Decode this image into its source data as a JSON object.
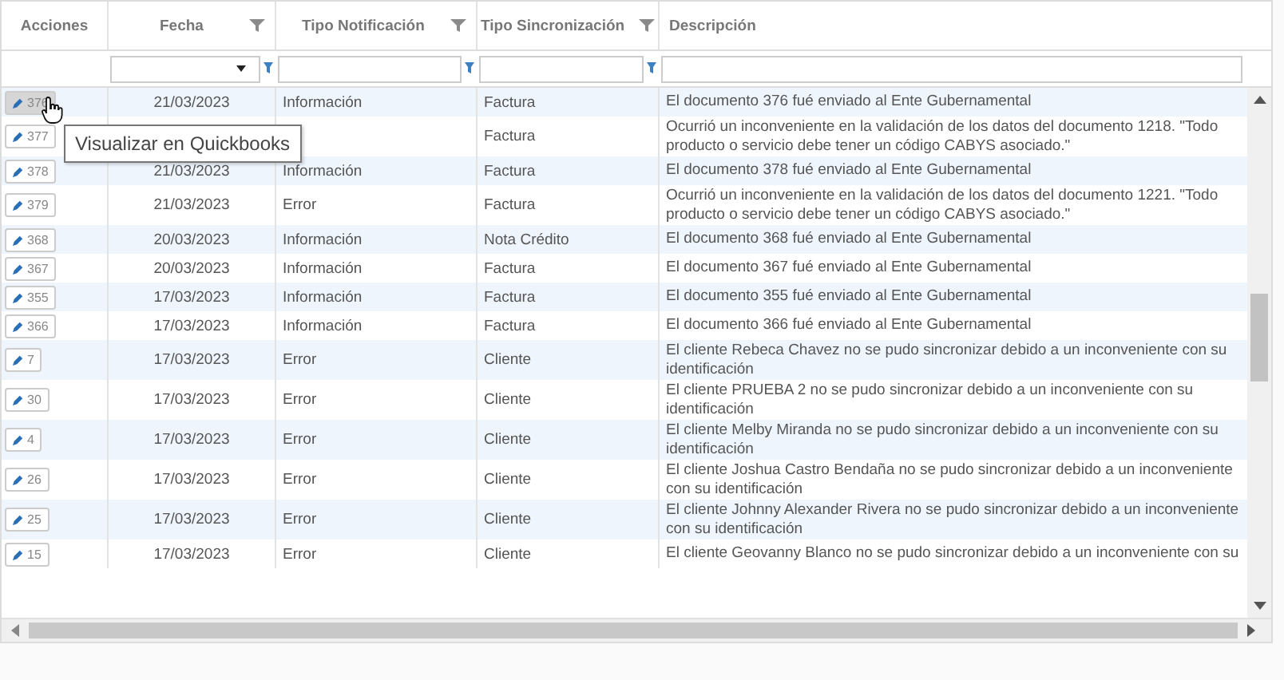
{
  "columns": [
    {
      "label": "Acciones",
      "filterable": false
    },
    {
      "label": "Fecha",
      "filterable": true
    },
    {
      "label": "Tipo Notificación",
      "filterable": true
    },
    {
      "label": "Tipo Sincronización",
      "filterable": true
    },
    {
      "label": "Descripción",
      "filterable": false
    }
  ],
  "filters": [
    {
      "kind": "dropdown"
    },
    {
      "kind": "text"
    },
    {
      "kind": "text"
    },
    {
      "kind": "text"
    }
  ],
  "rows": [
    {
      "id": "376",
      "date": "21/03/2023",
      "notification": "Información",
      "sync": "Factura",
      "description": "El documento 376 fué enviado al Ente Gubernamental",
      "hovered": true
    },
    {
      "id": "377",
      "sync": "Factura",
      "description": "Ocurrió un inconveniente en la validación de los datos del documento 1218. \"Todo producto o servicio debe tener un código CABYS asociado.\"",
      "hovered": false
    },
    {
      "id": "378",
      "date": "21/03/2023",
      "notification": "Información",
      "sync": "Factura",
      "description": "El documento 378 fué enviado al Ente Gubernamental",
      "hovered": false
    },
    {
      "id": "379",
      "date": "21/03/2023",
      "notification": "Error",
      "sync": "Factura",
      "description": "Ocurrió un inconveniente en la validación de los datos del documento 1221. \"Todo producto o servicio debe tener un código CABYS asociado.\"",
      "hovered": false
    },
    {
      "id": "368",
      "date": "20/03/2023",
      "notification": "Información",
      "sync": "Nota Crédito",
      "description": "El documento 368 fué enviado al Ente Gubernamental",
      "hovered": false
    },
    {
      "id": "367",
      "date": "20/03/2023",
      "notification": "Información",
      "sync": "Factura",
      "description": "El documento 367 fué enviado al Ente Gubernamental",
      "hovered": false
    },
    {
      "id": "355",
      "date": "17/03/2023",
      "notification": "Información",
      "sync": "Factura",
      "description": "El documento 355 fué enviado al Ente Gubernamental",
      "hovered": false
    },
    {
      "id": "366",
      "date": "17/03/2023",
      "notification": "Información",
      "sync": "Factura",
      "description": "El documento 366 fué enviado al Ente Gubernamental",
      "hovered": false
    },
    {
      "id": "7",
      "date": "17/03/2023",
      "notification": "Error",
      "sync": "Cliente",
      "description": "El cliente Rebeca Chavez no se pudo sincronizar debido a un inconveniente con su identificación",
      "hovered": false
    },
    {
      "id": "30",
      "date": "17/03/2023",
      "notification": "Error",
      "sync": "Cliente",
      "description": "El cliente PRUEBA 2 no se pudo sincronizar debido a un inconveniente con su identificación",
      "hovered": false
    },
    {
      "id": "4",
      "date": "17/03/2023",
      "notification": "Error",
      "sync": "Cliente",
      "description": "El cliente Melby Miranda no se pudo sincronizar debido a un inconveniente con su identificación",
      "hovered": false
    },
    {
      "id": "26",
      "date": "17/03/2023",
      "notification": "Error",
      "sync": "Cliente",
      "description": "El cliente Joshua Castro Bendaña no se pudo sincronizar debido a un inconveniente con su identificación",
      "hovered": false
    },
    {
      "id": "25",
      "date": "17/03/2023",
      "notification": "Error",
      "sync": "Cliente",
      "description": "El cliente Johnny Alexander Rivera no se pudo sincronizar debido a un inconveniente con su identificación",
      "hovered": false
    },
    {
      "id": "15",
      "date": "17/03/2023",
      "notification": "Error",
      "sync": "Cliente",
      "description": "El cliente Geovanny Blanco no se pudo sincronizar debido a un inconveniente con su",
      "hovered": false
    }
  ],
  "tooltip": {
    "text": "Visualizar en Quickbooks"
  }
}
